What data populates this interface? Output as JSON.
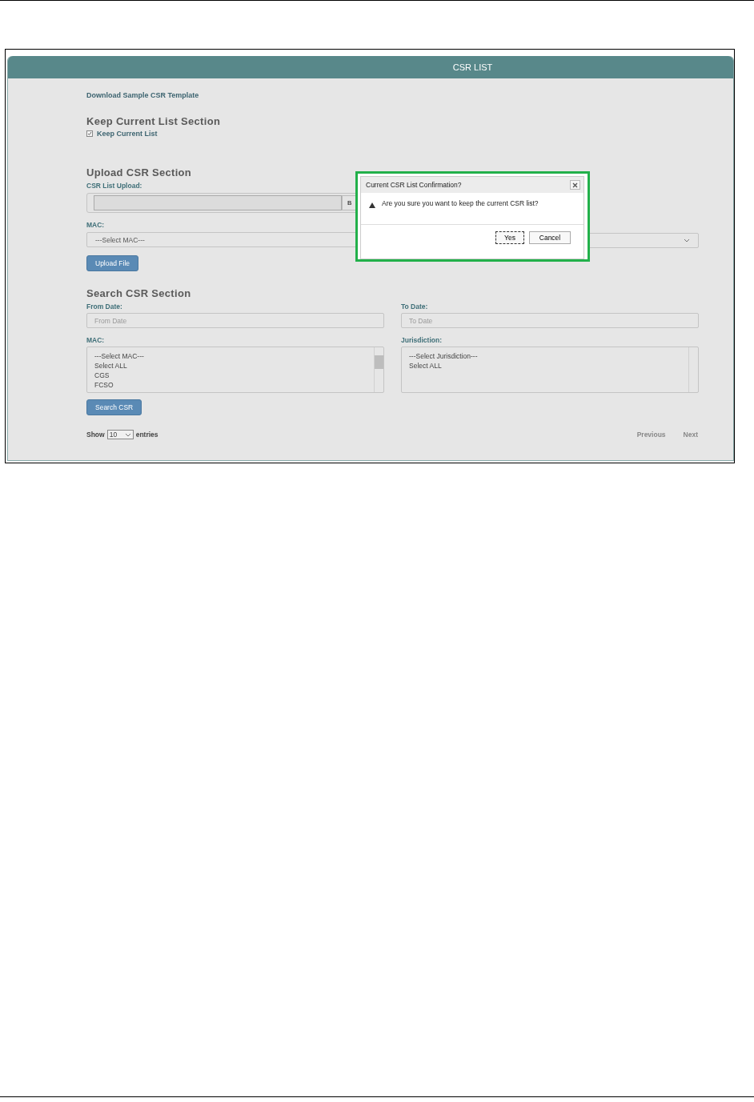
{
  "page_title": "CSR LIST",
  "download_link": "Download Sample CSR Template",
  "keep_section": {
    "heading": "Keep Current List Section",
    "checkbox": {
      "label": "Keep Current List",
      "checked": true
    }
  },
  "upload_section": {
    "heading": "Upload CSR Section",
    "file_label": "CSR List Upload:",
    "browse_button": "B",
    "mac_label": "MAC:",
    "mac_select": "---Select MAC---",
    "button": "Upload File"
  },
  "search_section": {
    "heading": "Search CSR Section",
    "from_label": "From Date:",
    "from_placeholder": "From Date",
    "to_label": "To Date:",
    "to_placeholder": "To Date",
    "mac_label": "MAC:",
    "mac_options": [
      "---Select MAC---",
      "Select ALL",
      "CGS",
      "FCSO"
    ],
    "jurisdiction_label": "Jurisdiction:",
    "jurisdiction_options": [
      "---Select Jurisdiction---",
      "Select ALL"
    ],
    "button": "Search CSR"
  },
  "pagination": {
    "show": "Show",
    "page_size": "10",
    "entries": "entries",
    "previous": "Previous",
    "next": "Next"
  },
  "dialog": {
    "title": "Current CSR List Confirmation?",
    "message": "Are you sure you want to keep the current CSR list?",
    "buttons": [
      {
        "label": "Yes",
        "focused": true
      },
      {
        "label": "Cancel",
        "focused": false
      }
    ]
  }
}
